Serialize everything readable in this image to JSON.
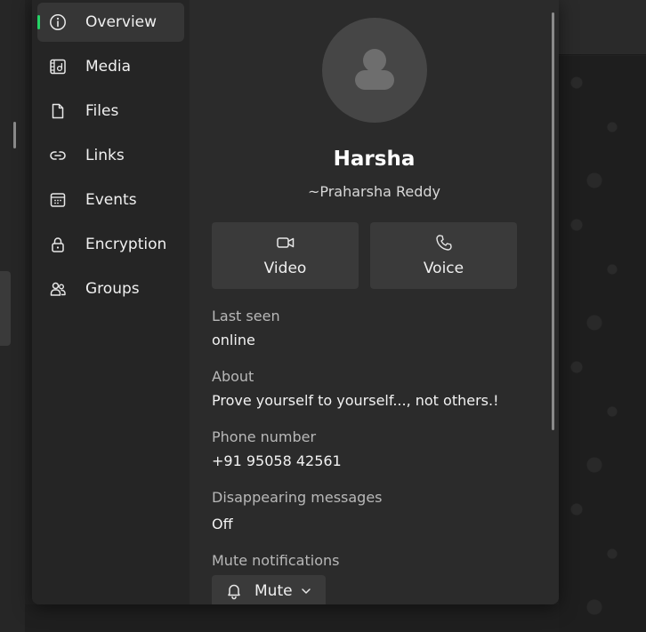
{
  "nav": {
    "items": [
      {
        "label": "Overview",
        "icon": "info-icon",
        "active": true
      },
      {
        "label": "Media",
        "icon": "media-icon",
        "active": false
      },
      {
        "label": "Files",
        "icon": "file-icon",
        "active": false
      },
      {
        "label": "Links",
        "icon": "link-icon",
        "active": false
      },
      {
        "label": "Events",
        "icon": "calendar-icon",
        "active": false
      },
      {
        "label": "Encryption",
        "icon": "lock-icon",
        "active": false
      },
      {
        "label": "Groups",
        "icon": "groups-icon",
        "active": false
      }
    ]
  },
  "profile": {
    "name": "Harsha",
    "subname": "~Praharsha Reddy",
    "avatar_icon": "person-icon"
  },
  "actions": {
    "video_label": "Video",
    "voice_label": "Voice"
  },
  "details": {
    "last_seen_label": "Last seen",
    "last_seen_value": "online",
    "about_label": "About",
    "about_value": "Prove yourself to yourself..., not others.!",
    "phone_label": "Phone number",
    "phone_value": "+91 95058 42561",
    "disappearing_label": "Disappearing messages",
    "disappearing_value": "Off",
    "mute_label": "Mute notifications",
    "mute_button_label": "Mute"
  },
  "colors": {
    "accent": "#25d366",
    "panel_bg": "#2b2b2b",
    "nav_bg": "#252525",
    "button_bg": "#3a3a3a"
  }
}
